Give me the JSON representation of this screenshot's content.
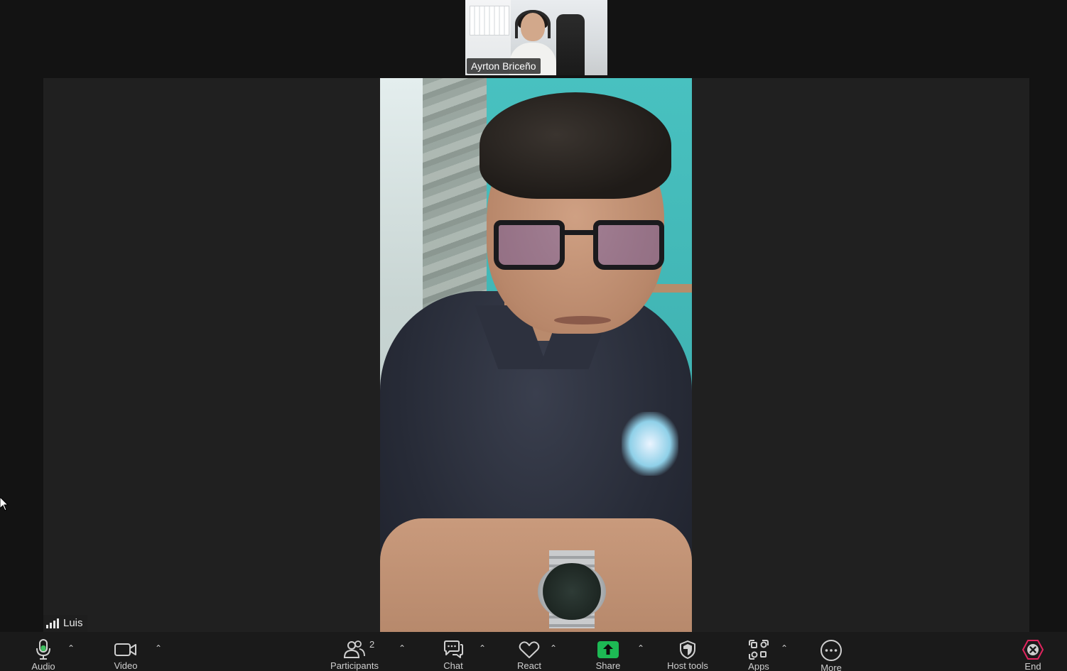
{
  "meeting": {
    "thumbnail_participant_name": "Ayrton Briceño",
    "active_speaker_name": "Luis"
  },
  "toolbar": {
    "audio_label": "Audio",
    "video_label": "Video",
    "participants_label": "Participants",
    "participants_count": "2",
    "chat_label": "Chat",
    "react_label": "React",
    "share_label": "Share",
    "host_tools_label": "Host tools",
    "apps_label": "Apps",
    "more_label": "More",
    "end_label": "End"
  },
  "colors": {
    "background": "#131313",
    "stage": "#202020",
    "toolbar": "#1a1a1a",
    "share_green": "#1db954",
    "end_red": "#e0245e",
    "mic_green": "#3fbf5f"
  },
  "icons": {
    "audio": "microphone-icon",
    "video": "video-camera-icon",
    "participants": "people-icon",
    "chat": "chat-bubbles-icon",
    "react": "heart-icon",
    "share": "share-up-arrow-icon",
    "host_tools": "shield-icon",
    "apps": "apps-grid-icon",
    "more": "more-dots-icon",
    "end": "end-x-icon",
    "caret": "caret-up-icon",
    "signal": "signal-bars-icon"
  }
}
